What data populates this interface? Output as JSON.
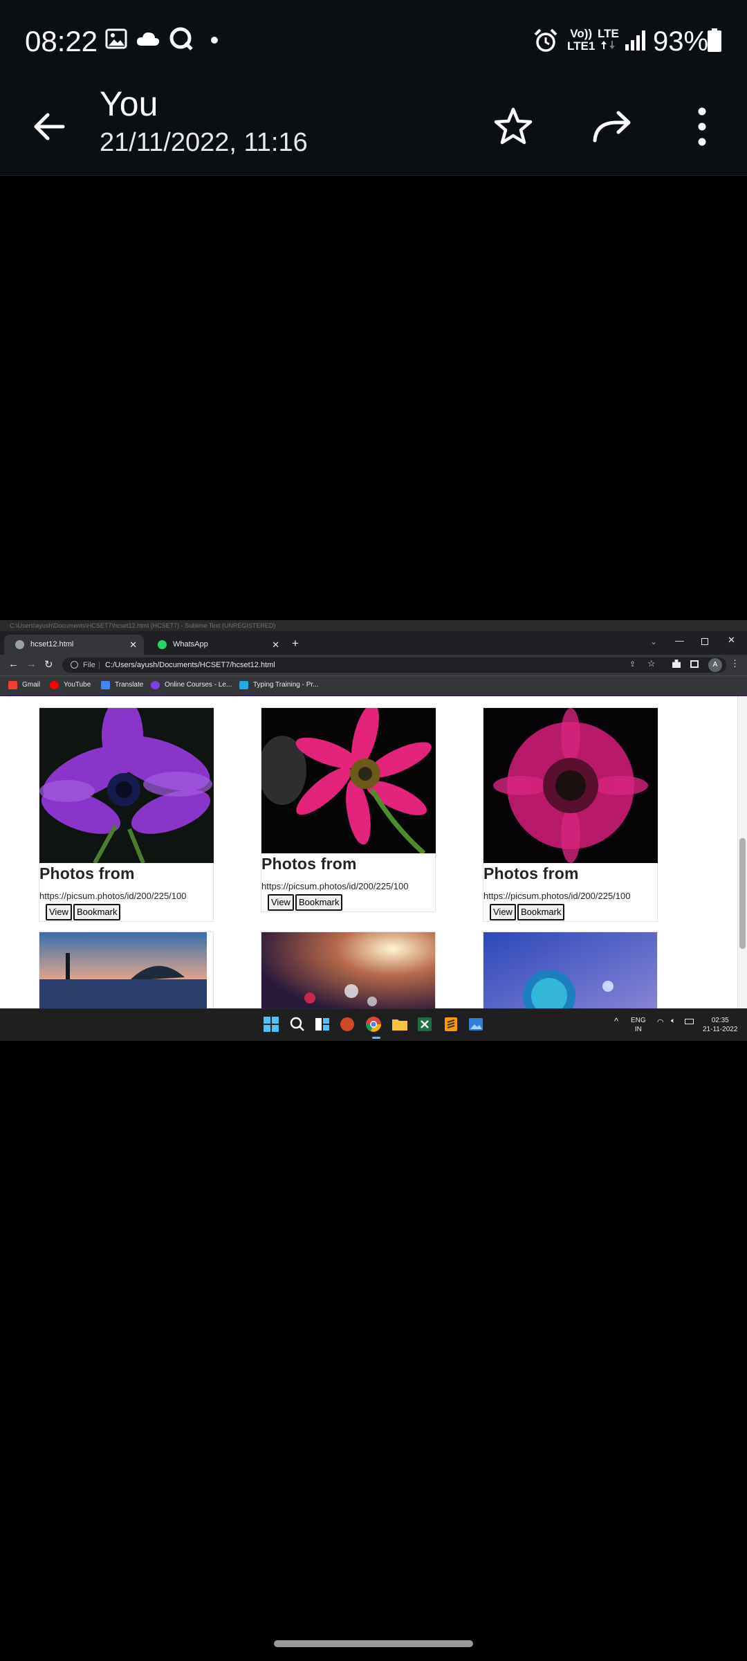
{
  "status_bar": {
    "time": "08:22",
    "network_top": "Vo))",
    "network_bottom": "LTE1",
    "lte_label": "LTE",
    "battery": "93%"
  },
  "header": {
    "title": "You",
    "subtitle": "21/11/2022, 11:16"
  },
  "screenshot": {
    "window_title": "C:\\Users\\ayush\\Documents\\HCSET7\\hcset12.html (HCSET7) - Sublime Text (UNREGISTERED)",
    "tabs": [
      {
        "label": "hcset12.html"
      },
      {
        "label": "WhatsApp"
      }
    ],
    "address": {
      "scheme": "File",
      "url": "C:/Users/ayush/Documents/HCSET7/hcset12.html"
    },
    "profile_initial": "A",
    "bookmarks": [
      "Gmail",
      "YouTube",
      "Translate",
      "Online Courses - Le...",
      "Typing Training - Pr..."
    ],
    "cards": [
      {
        "title": "Photos from",
        "url": "https://picsum.photos/id/200/225/100",
        "view": "View",
        "bookmark": "Bookmark"
      },
      {
        "title": "Photos from",
        "url": "https://picsum.photos/id/200/225/100",
        "view": "View",
        "bookmark": "Bookmark"
      },
      {
        "title": "Photos from",
        "url": "https://picsum.photos/id/200/225/100",
        "view": "View",
        "bookmark": "Bookmark"
      }
    ],
    "taskbar": {
      "lang_top": "ENG",
      "lang_bottom": "IN",
      "clock_time": "02:35",
      "clock_date": "21-11-2022"
    }
  }
}
